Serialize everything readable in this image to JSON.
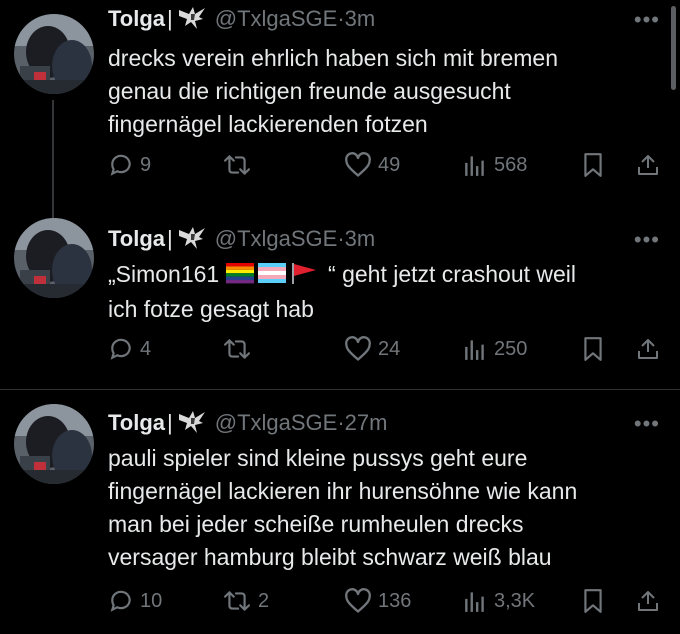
{
  "tweets": [
    {
      "name": "Tolga",
      "separator": "|",
      "handle": "@TxlgaSGE",
      "dot": "·",
      "time": "3m",
      "lines": [
        {
          "text": "drecks verein ehrlich haben sich mit bremen"
        },
        {
          "text": "genau die richtigen freunde ausgesucht"
        },
        {
          "text": "fingernägel lackierenden fotzen"
        }
      ],
      "replies": "9",
      "reposts": "",
      "likes": "49",
      "views": "568"
    },
    {
      "name": "Tolga",
      "separator": "|",
      "handle": "@TxlgaSGE",
      "dot": "·",
      "time": "3m",
      "lines": [
        {
          "prefix": "„Simon161",
          "suffix": "“ geht jetzt crashout weil"
        },
        {
          "text": "ich fotze gesagt hab"
        }
      ],
      "replies": "4",
      "reposts": "",
      "likes": "24",
      "views": "250"
    },
    {
      "name": "Tolga",
      "separator": "|",
      "handle": "@TxlgaSGE",
      "dot": "·",
      "time": "27m",
      "lines": [
        {
          "text": "pauli spieler sind kleine pussys geht eure"
        },
        {
          "text": "fingernägel lackieren ihr hurensöhne wie kann"
        },
        {
          "text": "man bei jeder scheiße rumheulen drecks"
        },
        {
          "text": "versager hamburg bleibt schwarz weiß blau"
        }
      ],
      "replies": "10",
      "reposts": "2",
      "likes": "136",
      "views": "3,3K"
    }
  ],
  "emoji_flags": [
    "rainbow-flag",
    "transgender-flag",
    "red-flag"
  ],
  "colors": {
    "background": "#000000",
    "text": "#e7e9ea",
    "muted": "#71767b",
    "divider": "#2f3336"
  }
}
